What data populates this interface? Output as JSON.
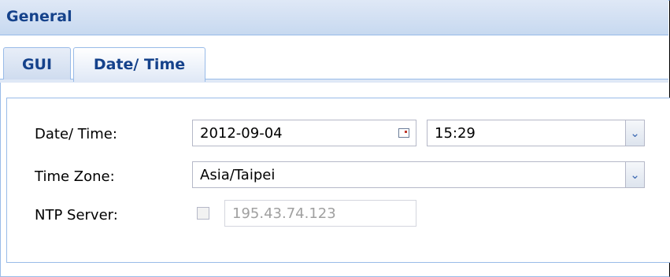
{
  "panel": {
    "title": "General"
  },
  "tabs": [
    {
      "label": "GUI",
      "active": false
    },
    {
      "label": "Date/ Time",
      "active": true
    }
  ],
  "form": {
    "datetime": {
      "label": "Date/ Time:",
      "date_value": "2012-09-04",
      "time_value": "15:29"
    },
    "timezone": {
      "label": "Time Zone:",
      "value": "Asia/Taipei"
    },
    "ntp": {
      "label": "NTP Server:",
      "enabled": false,
      "value": "195.43.74.123"
    }
  },
  "icons": {
    "date_picker": "calendar-icon",
    "dropdown": "chevron-down-icon"
  },
  "colors": {
    "header_text": "#15428b",
    "border": "#99bbe8",
    "header_bg": "#c7d9f0",
    "disabled_text": "#a0a0a0"
  }
}
